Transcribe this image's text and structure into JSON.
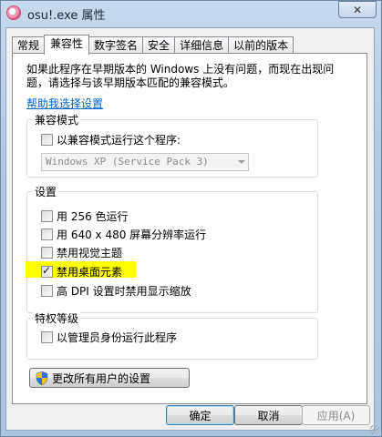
{
  "window": {
    "title": "osu!.exe 属性",
    "close_glyph": "✕"
  },
  "tabs": [
    {
      "label": "常规"
    },
    {
      "label": "兼容性"
    },
    {
      "label": "数字签名"
    },
    {
      "label": "安全"
    },
    {
      "label": "详细信息"
    },
    {
      "label": "以前的版本"
    }
  ],
  "compat": {
    "intro": "如果此程序在早期版本的 Windows 上没有问题，而现在出现问题，请选择与该早期版本匹配的兼容模式。",
    "help_link": "帮助我选择设置",
    "mode_group": {
      "title": "兼容模式",
      "checkbox_label": "以兼容模式运行这个程序:",
      "checked": false,
      "selected_os": "Windows XP (Service Pack 3)"
    },
    "settings_group": {
      "title": "设置",
      "items": [
        {
          "label": "用 256 色运行",
          "checked": false
        },
        {
          "label": "用 640 x 480 屏幕分辨率运行",
          "checked": false
        },
        {
          "label": "禁用视觉主题",
          "checked": false
        },
        {
          "label": "禁用桌面元素",
          "checked": true
        },
        {
          "label": "高 DPI 设置时禁用显示缩放",
          "checked": false
        }
      ]
    },
    "privilege_group": {
      "title": "特权等级",
      "checkbox_label": "以管理员身份运行此程序",
      "checked": false
    },
    "all_users_button": "更改所有用户的设置"
  },
  "buttons": {
    "ok": "确定",
    "cancel": "取消",
    "apply": "应用(A)"
  },
  "colors": {
    "highlight": "#ffff00",
    "link": "#0066cc"
  }
}
